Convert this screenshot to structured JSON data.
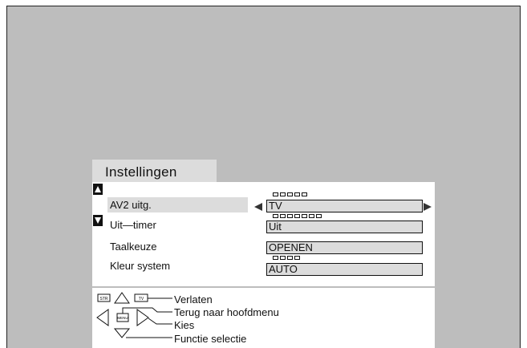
{
  "menu": {
    "title": "Instellingen",
    "items": [
      {
        "label": "AV2 uitg.",
        "value": "TV",
        "selected": true,
        "dots": 5
      },
      {
        "label": "Uit—timer",
        "value": "Uit",
        "selected": false,
        "dots": 7
      },
      {
        "label": "Taalkeuze",
        "value": "OPENEN",
        "selected": false,
        "dots": 0
      },
      {
        "label": "Kleur system",
        "value": "AUTO",
        "selected": false,
        "dots": 4
      }
    ]
  },
  "help": {
    "str_key": "STR",
    "tv_key": "TV",
    "menu_key": "MENU",
    "verlaten": "Verlaten",
    "terug": "Terug naar hoofdmenu",
    "kies": "Kies",
    "functie": "Functie selectie"
  },
  "colors": {
    "screen": "#bdbdbd",
    "highlight": "#dcdcdc",
    "panel": "#ffffff"
  }
}
